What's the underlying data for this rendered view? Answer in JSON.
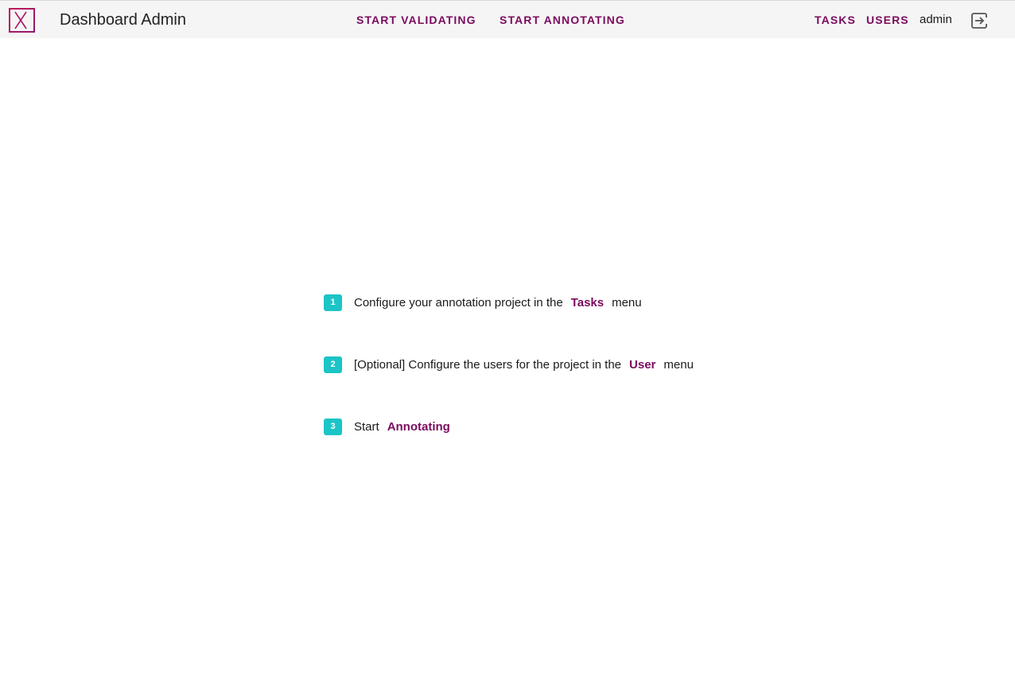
{
  "header": {
    "app_title": "Dashboard Admin",
    "nav": {
      "start_validating": "START VALIDATING",
      "start_annotating": "START ANNOTATING",
      "tasks": "TASKS",
      "users": "USERS"
    },
    "username": "admin",
    "logo_icon": "x-logo-icon",
    "logout_icon": "logout-icon"
  },
  "steps": [
    {
      "number": "1",
      "before": "Configure your annotation project in the",
      "link": "Tasks",
      "after": "menu"
    },
    {
      "number": "2",
      "before": "[Optional] Configure the users for the project in the",
      "link": "User",
      "after": "menu"
    },
    {
      "number": "3",
      "before": "Start",
      "link": "Annotating",
      "after": ""
    }
  ],
  "colors": {
    "accent": "#7a0b5e",
    "badge": "#1cc4c6",
    "header_bg": "#f5f5f5"
  }
}
